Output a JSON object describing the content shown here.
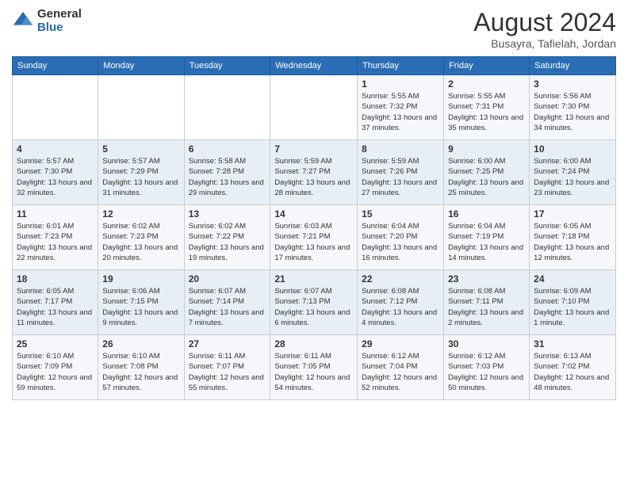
{
  "header": {
    "logo_general": "General",
    "logo_blue": "Blue",
    "month_title": "August 2024",
    "location": "Busayra, Tafielah, Jordan"
  },
  "days_of_week": [
    "Sunday",
    "Monday",
    "Tuesday",
    "Wednesday",
    "Thursday",
    "Friday",
    "Saturday"
  ],
  "weeks": [
    [
      {
        "day": "",
        "sunrise": "",
        "sunset": "",
        "daylight": ""
      },
      {
        "day": "",
        "sunrise": "",
        "sunset": "",
        "daylight": ""
      },
      {
        "day": "",
        "sunrise": "",
        "sunset": "",
        "daylight": ""
      },
      {
        "day": "",
        "sunrise": "",
        "sunset": "",
        "daylight": ""
      },
      {
        "day": "1",
        "sunrise": "5:55 AM",
        "sunset": "7:32 PM",
        "daylight": "13 hours and 37 minutes."
      },
      {
        "day": "2",
        "sunrise": "5:55 AM",
        "sunset": "7:31 PM",
        "daylight": "13 hours and 35 minutes."
      },
      {
        "day": "3",
        "sunrise": "5:56 AM",
        "sunset": "7:30 PM",
        "daylight": "13 hours and 34 minutes."
      }
    ],
    [
      {
        "day": "4",
        "sunrise": "5:57 AM",
        "sunset": "7:30 PM",
        "daylight": "13 hours and 32 minutes."
      },
      {
        "day": "5",
        "sunrise": "5:57 AM",
        "sunset": "7:29 PM",
        "daylight": "13 hours and 31 minutes."
      },
      {
        "day": "6",
        "sunrise": "5:58 AM",
        "sunset": "7:28 PM",
        "daylight": "13 hours and 29 minutes."
      },
      {
        "day": "7",
        "sunrise": "5:59 AM",
        "sunset": "7:27 PM",
        "daylight": "13 hours and 28 minutes."
      },
      {
        "day": "8",
        "sunrise": "5:59 AM",
        "sunset": "7:26 PM",
        "daylight": "13 hours and 27 minutes."
      },
      {
        "day": "9",
        "sunrise": "6:00 AM",
        "sunset": "7:25 PM",
        "daylight": "13 hours and 25 minutes."
      },
      {
        "day": "10",
        "sunrise": "6:00 AM",
        "sunset": "7:24 PM",
        "daylight": "13 hours and 23 minutes."
      }
    ],
    [
      {
        "day": "11",
        "sunrise": "6:01 AM",
        "sunset": "7:23 PM",
        "daylight": "13 hours and 22 minutes."
      },
      {
        "day": "12",
        "sunrise": "6:02 AM",
        "sunset": "7:23 PM",
        "daylight": "13 hours and 20 minutes."
      },
      {
        "day": "13",
        "sunrise": "6:02 AM",
        "sunset": "7:22 PM",
        "daylight": "13 hours and 19 minutes."
      },
      {
        "day": "14",
        "sunrise": "6:03 AM",
        "sunset": "7:21 PM",
        "daylight": "13 hours and 17 minutes."
      },
      {
        "day": "15",
        "sunrise": "6:04 AM",
        "sunset": "7:20 PM",
        "daylight": "13 hours and 16 minutes."
      },
      {
        "day": "16",
        "sunrise": "6:04 AM",
        "sunset": "7:19 PM",
        "daylight": "13 hours and 14 minutes."
      },
      {
        "day": "17",
        "sunrise": "6:05 AM",
        "sunset": "7:18 PM",
        "daylight": "13 hours and 12 minutes."
      }
    ],
    [
      {
        "day": "18",
        "sunrise": "6:05 AM",
        "sunset": "7:17 PM",
        "daylight": "13 hours and 11 minutes."
      },
      {
        "day": "19",
        "sunrise": "6:06 AM",
        "sunset": "7:15 PM",
        "daylight": "13 hours and 9 minutes."
      },
      {
        "day": "20",
        "sunrise": "6:07 AM",
        "sunset": "7:14 PM",
        "daylight": "13 hours and 7 minutes."
      },
      {
        "day": "21",
        "sunrise": "6:07 AM",
        "sunset": "7:13 PM",
        "daylight": "13 hours and 6 minutes."
      },
      {
        "day": "22",
        "sunrise": "6:08 AM",
        "sunset": "7:12 PM",
        "daylight": "13 hours and 4 minutes."
      },
      {
        "day": "23",
        "sunrise": "6:08 AM",
        "sunset": "7:11 PM",
        "daylight": "13 hours and 2 minutes."
      },
      {
        "day": "24",
        "sunrise": "6:09 AM",
        "sunset": "7:10 PM",
        "daylight": "13 hours and 1 minute."
      }
    ],
    [
      {
        "day": "25",
        "sunrise": "6:10 AM",
        "sunset": "7:09 PM",
        "daylight": "12 hours and 59 minutes."
      },
      {
        "day": "26",
        "sunrise": "6:10 AM",
        "sunset": "7:08 PM",
        "daylight": "12 hours and 57 minutes."
      },
      {
        "day": "27",
        "sunrise": "6:11 AM",
        "sunset": "7:07 PM",
        "daylight": "12 hours and 55 minutes."
      },
      {
        "day": "28",
        "sunrise": "6:11 AM",
        "sunset": "7:05 PM",
        "daylight": "12 hours and 54 minutes."
      },
      {
        "day": "29",
        "sunrise": "6:12 AM",
        "sunset": "7:04 PM",
        "daylight": "12 hours and 52 minutes."
      },
      {
        "day": "30",
        "sunrise": "6:12 AM",
        "sunset": "7:03 PM",
        "daylight": "12 hours and 50 minutes."
      },
      {
        "day": "31",
        "sunrise": "6:13 AM",
        "sunset": "7:02 PM",
        "daylight": "12 hours and 48 minutes."
      }
    ]
  ]
}
